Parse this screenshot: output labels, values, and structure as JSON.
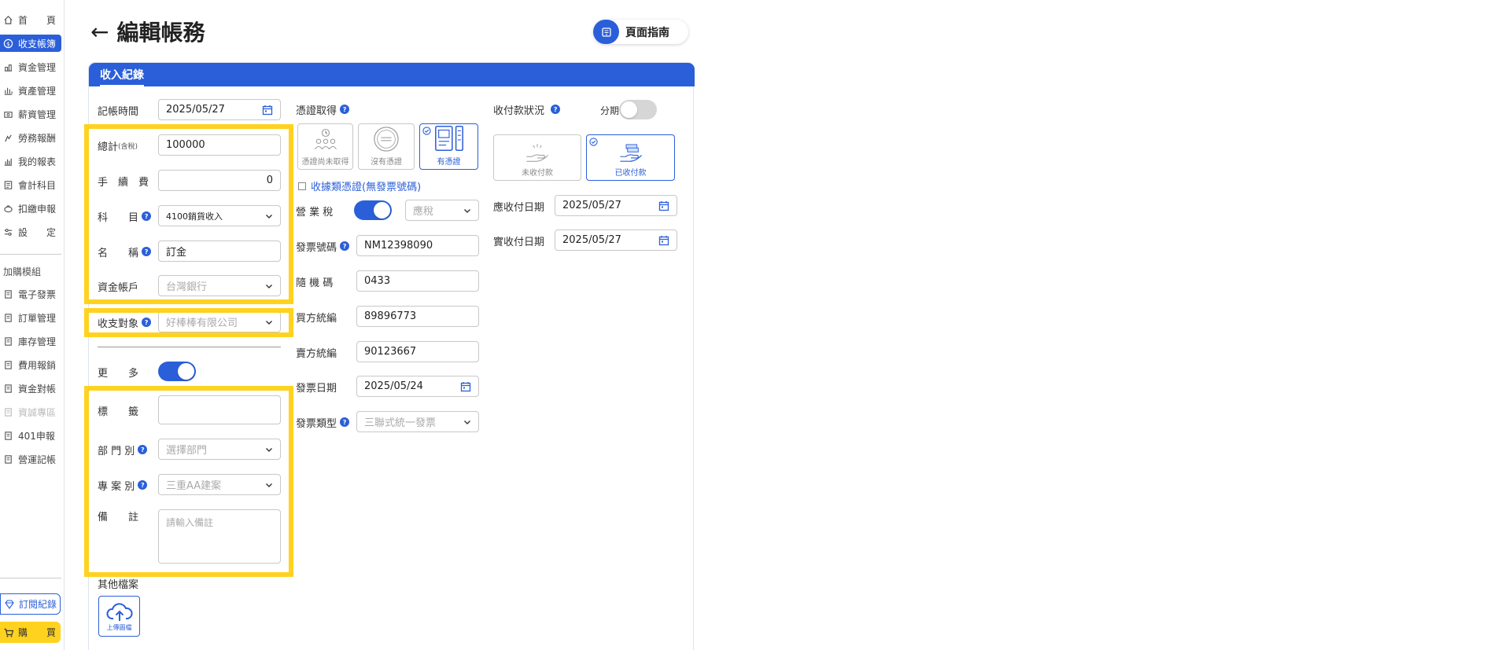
{
  "sidebar": {
    "items": [
      {
        "label": "首　　頁",
        "icon": "home-icon"
      },
      {
        "label": "收支帳簿",
        "icon": "ledger-icon",
        "active": true
      },
      {
        "label": "資金管理",
        "icon": "fund-icon"
      },
      {
        "label": "資產管理",
        "icon": "asset-icon"
      },
      {
        "label": "薪資管理",
        "icon": "salary-icon"
      },
      {
        "label": "勞務報酬",
        "icon": "labor-icon"
      },
      {
        "label": "我的報表",
        "icon": "report-icon"
      },
      {
        "label": "會計科目",
        "icon": "account-icon"
      },
      {
        "label": "扣繳申報",
        "icon": "withholding-icon"
      },
      {
        "label": "設　　定",
        "icon": "settings-icon"
      }
    ],
    "addon_group": "加購模組",
    "addon_items": [
      {
        "label": "電子發票",
        "icon": "einvoice-icon"
      },
      {
        "label": "訂單管理",
        "icon": "order-icon"
      },
      {
        "label": "庫存管理",
        "icon": "inventory-icon"
      },
      {
        "label": "費用報銷",
        "icon": "expense-icon"
      },
      {
        "label": "資金對帳",
        "icon": "reconcile-icon"
      },
      {
        "label": "資誠專區",
        "icon": "pwc-icon",
        "disabled": true
      },
      {
        "label": "401申報",
        "icon": "tax401-icon"
      },
      {
        "label": "營運記帳",
        "icon": "operation-icon"
      }
    ],
    "subscription_label": "訂閱紀錄",
    "buy_label": "購　　買"
  },
  "header": {
    "title": "編輯帳務",
    "guide_label": "頁面指南"
  },
  "card": {
    "tab_label": "收入紀錄"
  },
  "form": {
    "record_time_label": "記帳時間",
    "record_time_value": "2025/05/27",
    "total_label": "總計",
    "total_suffix": "(含稅)",
    "total_value": "100000",
    "fee_label": "手　續　費",
    "fee_value": "0",
    "subject_label": "科　　目",
    "subject_value": "4100銷貨收入",
    "name_label": "名　　稱",
    "name_value": "訂金",
    "fund_account_label": "資金帳戶",
    "fund_account_value": "台灣銀行",
    "counterparty_label": "收支對象",
    "counterparty_value": "好棒棒有限公司",
    "more_label": "更　　多",
    "tag_label": "標　　籤",
    "tag_value": "",
    "department_label": "部 門 別",
    "department_placeholder": "選擇部門",
    "project_label": "專 案 別",
    "project_value": "三重AA建案",
    "note_label": "備　　註",
    "note_placeholder": "請輸入備註",
    "other_files_label": "其他檔案",
    "upload_label": "上傳圖檔"
  },
  "voucher": {
    "label": "憑證取得",
    "options": [
      {
        "label": "憑證尚未取得",
        "icon": "people-clock-icon"
      },
      {
        "label": "沒有憑證",
        "icon": "stamp-icon"
      },
      {
        "label": "有憑證",
        "icon": "document-icon",
        "selected": true
      }
    ],
    "receipt_checkbox_label": "收據類憑證(無發票號碼)",
    "business_tax_label": "營 業 稅",
    "business_tax_value": "應稅",
    "invoice_number_label": "發票號碼",
    "invoice_number_value": "NM12398090",
    "random_code_label": "隨 機 碼",
    "random_code_value": "0433",
    "buyer_id_label": "買方統編",
    "buyer_id_value": "89896773",
    "seller_id_label": "賣方統編",
    "seller_id_value": "90123667",
    "invoice_date_label": "發票日期",
    "invoice_date_value": "2025/05/24",
    "invoice_type_label": "發票類型",
    "invoice_type_value": "三聯式統一發票"
  },
  "payment": {
    "label": "收付款狀況",
    "installment_label": "分期",
    "options": [
      {
        "label": "未收付款",
        "icon": "hand-empty-icon"
      },
      {
        "label": "已收付款",
        "icon": "hand-money-icon",
        "selected": true
      }
    ],
    "due_date_label": "應收付日期",
    "due_date_value": "2025/05/27",
    "actual_date_label": "實收付日期",
    "actual_date_value": "2025/05/27"
  },
  "colors": {
    "primary": "#2b5fd9",
    "highlight": "#ffd21f"
  }
}
